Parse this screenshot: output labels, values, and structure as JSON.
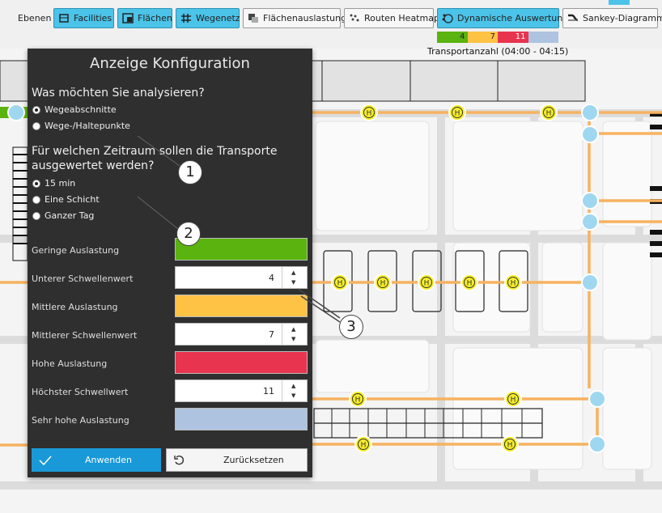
{
  "toolbar": {
    "label": "Ebenen",
    "buttons": [
      {
        "label": "Facilities",
        "active": true
      },
      {
        "label": "Flächen",
        "active": true
      },
      {
        "label": "Wegenetz",
        "active": true
      },
      {
        "label": "Flächenauslastung",
        "active": false
      },
      {
        "label": "Routen Heatmap",
        "active": false
      },
      {
        "label": "Dynamische Auswertung",
        "active": true
      },
      {
        "label": "Sankey-Diagramm",
        "active": false
      }
    ]
  },
  "legend": {
    "title": "Transportanzahl (04:00 - 04:15)",
    "segments": [
      {
        "label": "4",
        "color": "#5ab30e"
      },
      {
        "label": "7",
        "color": "#fec245"
      },
      {
        "label": "11",
        "color": "#e8344f"
      },
      {
        "label": "",
        "color": "#adc3e0"
      }
    ]
  },
  "dialog": {
    "title": "Anzeige Konfiguration",
    "q1": "Was möchten Sie analysieren?",
    "analyze_options": [
      {
        "label": "Wegeabschnitte",
        "checked": true
      },
      {
        "label": "Wege-/Haltepunkte",
        "checked": false
      }
    ],
    "q2_line1": "Für welchen Zeitraum sollen  die Transporte",
    "q2_line2": "ausgewertet werden?",
    "period_options": [
      {
        "label": "15 min",
        "checked": true
      },
      {
        "label": "Eine Schicht",
        "checked": false
      },
      {
        "label": "Ganzer Tag",
        "checked": false
      }
    ],
    "fields": {
      "low_label": "Geringe Auslastung",
      "low_color": "#5ab30e",
      "lower_threshold_label": "Unterer Schwellenwert",
      "lower_threshold": "4",
      "mid_label": "Mittlere Auslastung",
      "mid_color": "#fec245",
      "mid_threshold_label": "Mittlerer Schwellenwert",
      "mid_threshold": "7",
      "high_label": "Hohe Auslastung",
      "high_color": "#e8344f",
      "max_threshold_label": "Höchster Schwellwert",
      "max_threshold": "11",
      "very_high_label": "Sehr hohe Auslastung",
      "very_high_color": "#adc3e0"
    },
    "apply_label": "Anwenden",
    "reset_label": "Zurücksetzen"
  },
  "callouts": [
    "1",
    "2",
    "3"
  ],
  "colors": {
    "accent": "#4cc3e8",
    "route": "#f7b260",
    "stop": "#f6ee2a",
    "node": "#9fd7f0"
  }
}
